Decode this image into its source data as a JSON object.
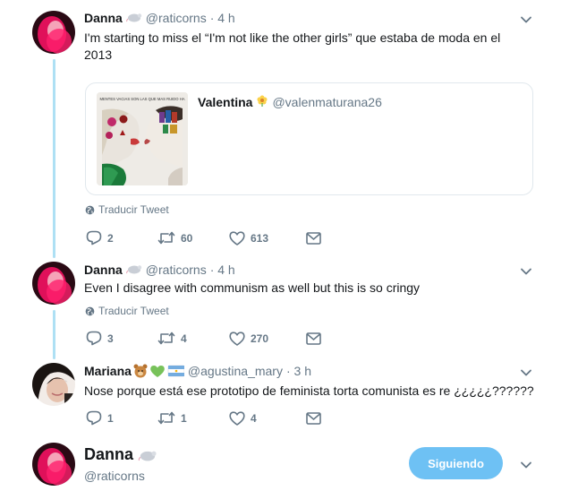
{
  "tweets": [
    {
      "name": "Danna",
      "emoji": "rat-emoji",
      "handle": "@raticorns",
      "time": "· 4 h",
      "text": "I'm starting to miss el “I'm not like the other girls” que estaba de moda en el 2013",
      "translate": "Traducir Tweet",
      "replies": "2",
      "retweets": "60",
      "likes": "613"
    },
    {
      "name": "Danna",
      "emoji": "rat-emoji",
      "handle": "@raticorns",
      "time": "· 4 h",
      "text": "Even I disagree with communism as well but this is so cringy",
      "translate": "Traducir Tweet",
      "replies": "3",
      "retweets": "4",
      "likes": "270"
    },
    {
      "name": "Mariana",
      "emoji": "bear-heart-argentina-emoji",
      "handle": "@agustina_mary",
      "time": "· 3 h",
      "text": "Nose porque está ese prototipo de feminista torta comunista es re ¿¿¿¿¿??????",
      "replies": "1",
      "retweets": "1",
      "likes": "4"
    }
  ],
  "quote": {
    "name": "Valentina",
    "emoji": "flower-emoji",
    "handle": "@valenmaturana26",
    "image_caption": "MENTES VACIAS SON LAS QUE MAS RUIDO HA"
  },
  "profile": {
    "name": "Danna",
    "handle": "@raticorns",
    "follow_label": "Siguiendo"
  },
  "colors": {
    "accent": "#1da1f2",
    "follow_button": "#6ec1f4",
    "thread_line": "#aee0f4",
    "muted": "#657786"
  }
}
